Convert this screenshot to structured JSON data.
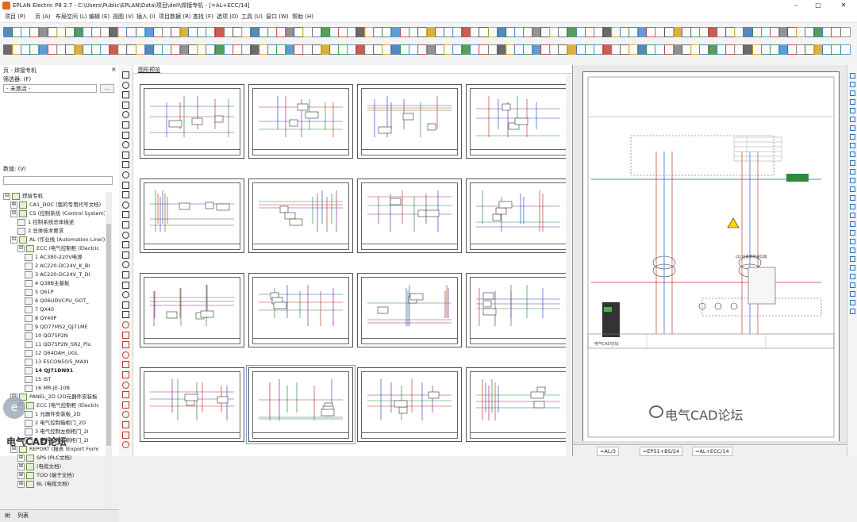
{
  "window": {
    "title": "EPLAN Electric P8 2.7 - C:\\Users\\Public\\EPLAN\\Data\\项目\\dell\\焊接专机 - [=AL+ECC/14]",
    "controls": [
      "–",
      "□",
      "✕"
    ]
  },
  "menu": [
    "项目 (P)",
    "页 (A)",
    "布局空间 (L)",
    "编辑 (E)",
    "视图 (V)",
    "插入 (I)",
    "项目数据 (R)",
    "查找 (F)",
    "选项 (O)",
    "工具 (U)",
    "窗口 (W)",
    "帮助 (H)"
  ],
  "colors": {
    "accent": "#2e6db4",
    "wire_red": "#c0392b",
    "wire_blue": "#2b55c0",
    "wire_purple": "#8a2b8f",
    "wire_green": "#2d8a3e"
  },
  "left_panel": {
    "title": "页 - 焊接专机",
    "close": "×",
    "filter_label": "筛选器: (F)",
    "filter_value": "- 未激活 -",
    "filter_button": "...",
    "value_label": "数值: (V)",
    "value_input": ""
  },
  "tree": [
    {
      "level": 0,
      "exp": "⊟",
      "icon": "folder",
      "label": "焊接专机"
    },
    {
      "level": 1,
      "exp": "⊞",
      "icon": "folder",
      "label": "CA1_DOC (我的专用代号文档)"
    },
    {
      "level": 1,
      "exp": "⊟",
      "icon": "folder",
      "label": "CS (控制系统 (Control System))"
    },
    {
      "level": 2,
      "exp": "",
      "icon": "page",
      "label": "1 控制系统总体描述"
    },
    {
      "level": 2,
      "exp": "",
      "icon": "page",
      "label": "2 总体技术要求"
    },
    {
      "level": 1,
      "exp": "⊟",
      "icon": "folder",
      "label": "AL (作业线 (Automation Line))"
    },
    {
      "level": 2,
      "exp": "⊟",
      "icon": "folder",
      "label": "ECC (电气控制柜 (Electric"
    },
    {
      "level": 3,
      "exp": "",
      "icon": "page",
      "label": "1 AC380-220V电源"
    },
    {
      "level": 3,
      "exp": "",
      "icon": "page",
      "label": "2 AC220-DC24V_K_BI"
    },
    {
      "level": 3,
      "exp": "",
      "icon": "page",
      "label": "3 AC220-DC24V_T_DI"
    },
    {
      "level": 3,
      "exp": "",
      "icon": "page",
      "label": "4 Q38B主基板"
    },
    {
      "level": 3,
      "exp": "",
      "icon": "page",
      "label": "5 Q61P"
    },
    {
      "level": 3,
      "exp": "",
      "icon": "page",
      "label": "6 Q06UDVCPU_GOT_"
    },
    {
      "level": 3,
      "exp": "",
      "icon": "page",
      "label": "7 QX40"
    },
    {
      "level": 3,
      "exp": "",
      "icon": "page",
      "label": "8 QY40P"
    },
    {
      "level": 3,
      "exp": "",
      "icon": "page",
      "label": "9 QD77MS2_QJ71ME"
    },
    {
      "level": 3,
      "exp": "",
      "icon": "page",
      "label": "10 QD75P2N"
    },
    {
      "level": 3,
      "exp": "",
      "icon": "page",
      "label": "11 QD75P2N_SR2_Plu"
    },
    {
      "level": 3,
      "exp": "",
      "icon": "page",
      "label": "12 Q64DAH_UGL"
    },
    {
      "level": 3,
      "exp": "",
      "icon": "page",
      "label": "13 ESCON50/5_MAXI"
    },
    {
      "level": 3,
      "exp": "",
      "icon": "page",
      "label": "14 QJ71DN91",
      "bold": true
    },
    {
      "level": 3,
      "exp": "",
      "icon": "page",
      "label": "15 IST"
    },
    {
      "level": 3,
      "exp": "",
      "icon": "page",
      "label": "16 MR-JE-10B"
    },
    {
      "level": 1,
      "exp": "⊟",
      "icon": "folder",
      "label": "PANEL_2D (2D元器件安装板"
    },
    {
      "level": 2,
      "exp": "⊟",
      "icon": "folder",
      "label": "ECC (电气控制柜 (Electric"
    },
    {
      "level": 3,
      "exp": "",
      "icon": "page",
      "label": "1 元器件安装板_2D"
    },
    {
      "level": 3,
      "exp": "",
      "icon": "page",
      "label": "2 电气控制箱柜门_2D"
    },
    {
      "level": 3,
      "exp": "",
      "icon": "page",
      "label": "3 电气控制左侧柜门_2I"
    },
    {
      "level": 3,
      "exp": "",
      "icon": "page",
      "label": "4 电气控制右侧柜门_2I"
    },
    {
      "level": 1,
      "exp": "⊟",
      "icon": "folder",
      "label": "REPORT (报表 (Export Form"
    },
    {
      "level": 2,
      "exp": "⊞",
      "icon": "folder",
      "label": "SPS (PLC文档)"
    },
    {
      "level": 2,
      "exp": "⊞",
      "icon": "folder",
      "label": "(电缆文档)"
    },
    {
      "level": 2,
      "exp": "⊞",
      "icon": "folder",
      "label": "TOD (端子文档)"
    },
    {
      "level": 2,
      "exp": "⊞",
      "icon": "folder",
      "label": "BL (电缆文档)"
    }
  ],
  "bottom_tabs": [
    "树",
    "列表"
  ],
  "thumbnails_header": "图形预览",
  "preview_tabs": [
    "=AL/3",
    "=EPS1+BS/24",
    "=AL+ECC/14"
  ],
  "preview": {
    "title_block_label": "电气CAD论坛",
    "section_heading": "CD 设备网络通信端"
  },
  "watermark": {
    "logo": "e",
    "left_text": "电气CAD论坛",
    "right_text": "电气CAD论坛"
  }
}
